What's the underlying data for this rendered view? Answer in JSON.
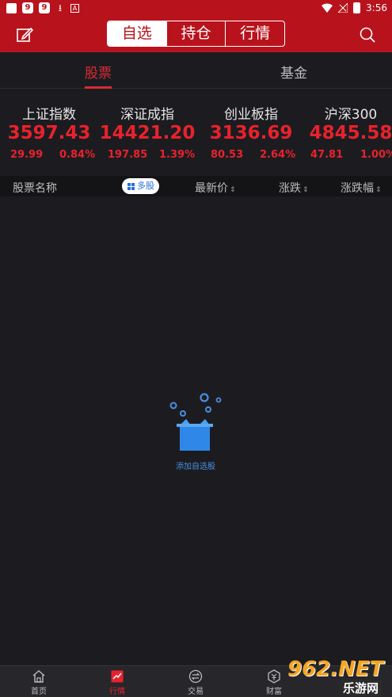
{
  "status_bar": {
    "time": "3:56",
    "left_icons": [
      "app-icon",
      "9",
      "9",
      "download-icon",
      "a-icon"
    ]
  },
  "header": {
    "segments": [
      {
        "label": "自选",
        "active": true
      },
      {
        "label": "持仓",
        "active": false
      },
      {
        "label": "行情",
        "active": false
      }
    ]
  },
  "subtabs": [
    {
      "label": "股票",
      "active": true
    },
    {
      "label": "基金",
      "active": false
    }
  ],
  "indices": [
    {
      "name": "上证指数",
      "value": "3597.43",
      "change": "29.99",
      "percent": "0.84%"
    },
    {
      "name": "深证成指",
      "value": "14421.20",
      "change": "197.85",
      "percent": "1.39%"
    },
    {
      "name": "创业板指",
      "value": "3136.69",
      "change": "80.53",
      "percent": "2.64%"
    },
    {
      "name": "沪深300",
      "value": "4845.58",
      "change": "47.81",
      "percent": "1.00%"
    }
  ],
  "columns": {
    "name": "股票名称",
    "multi_stock": "多股",
    "price": "最新价",
    "change": "涨跌",
    "change_pct": "涨跌幅",
    "sort_glyph": "⇕"
  },
  "empty_state": {
    "label": "添加自选股"
  },
  "tabbar": [
    {
      "label": "首页",
      "active": false
    },
    {
      "label": "行情",
      "active": true
    },
    {
      "label": "交易",
      "active": false
    },
    {
      "label": "财富",
      "active": false
    }
  ],
  "watermark": {
    "brand": "962.NET",
    "sub": "乐游网"
  },
  "colors": {
    "brand_red": "#b8131d",
    "up_red": "#e8222c",
    "accent_blue": "#4a8ee0",
    "background": "#1c1c20"
  }
}
